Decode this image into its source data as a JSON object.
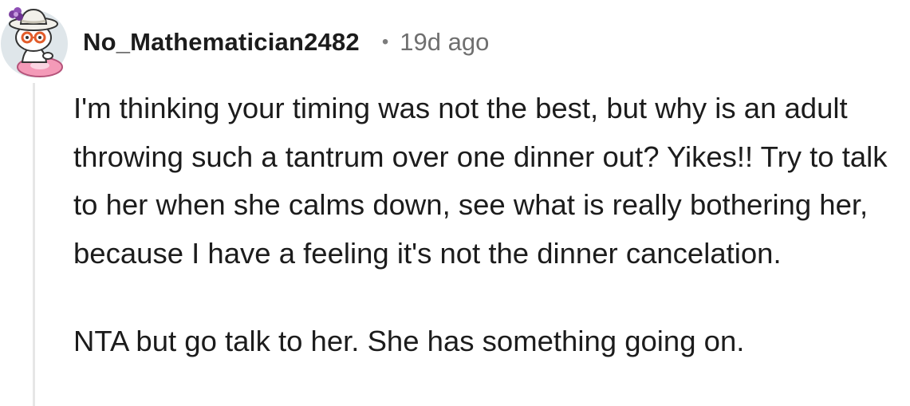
{
  "comment": {
    "username": "No_Mathematician2482",
    "separator": "•",
    "timestamp": "19d ago",
    "paragraphs": [
      "I'm thinking your timing was not the best, but why is an adult throwing such a tantrum over one dinner out? Yikes!! Try to talk to her when she calms down, see what is really bothering her, because I have a feeling it's not the dinner cancelation.",
      "NTA but go talk to her. She has something going on."
    ]
  },
  "colors": {
    "text": "#1c1c1c",
    "meta": "#6f6f6f",
    "thread_line": "#e6e6e6",
    "avatar_bg": "#dfe6ea",
    "hat": "#f2f0ea",
    "flower": "#7b3fa0",
    "glasses": "#e25c2a",
    "float": "#f49ab8"
  },
  "icons": {
    "avatar": "snoo-avatar-with-hat-glasses-pink-float"
  }
}
